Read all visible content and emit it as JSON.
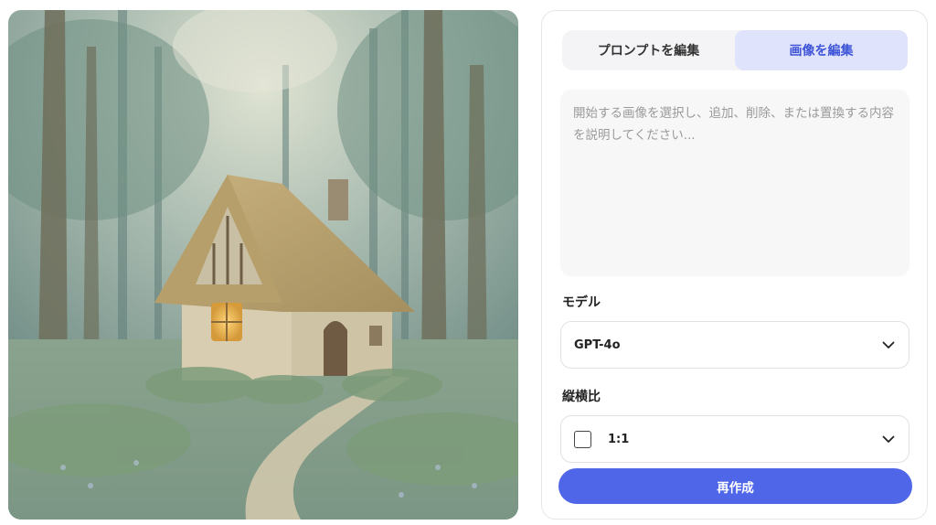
{
  "tabs": [
    {
      "label": "プロンプトを編集",
      "active": false
    },
    {
      "label": "画像を編集",
      "active": true
    }
  ],
  "prompt": {
    "placeholder": "開始する画像を選択し、追加、削除、または置換する内容を説明してください...",
    "value": ""
  },
  "model": {
    "label": "モデル",
    "selected": "GPT-4o",
    "icon": "chevron-down-icon"
  },
  "aspect": {
    "label": "縦横比",
    "selected": "1:1",
    "icon": "square-icon"
  },
  "actions": {
    "regenerate_label": "再作成"
  },
  "colors": {
    "accent": "#4f66e8",
    "active_tab_bg": "#dfe3fb",
    "active_tab_text": "#3f55d8"
  }
}
